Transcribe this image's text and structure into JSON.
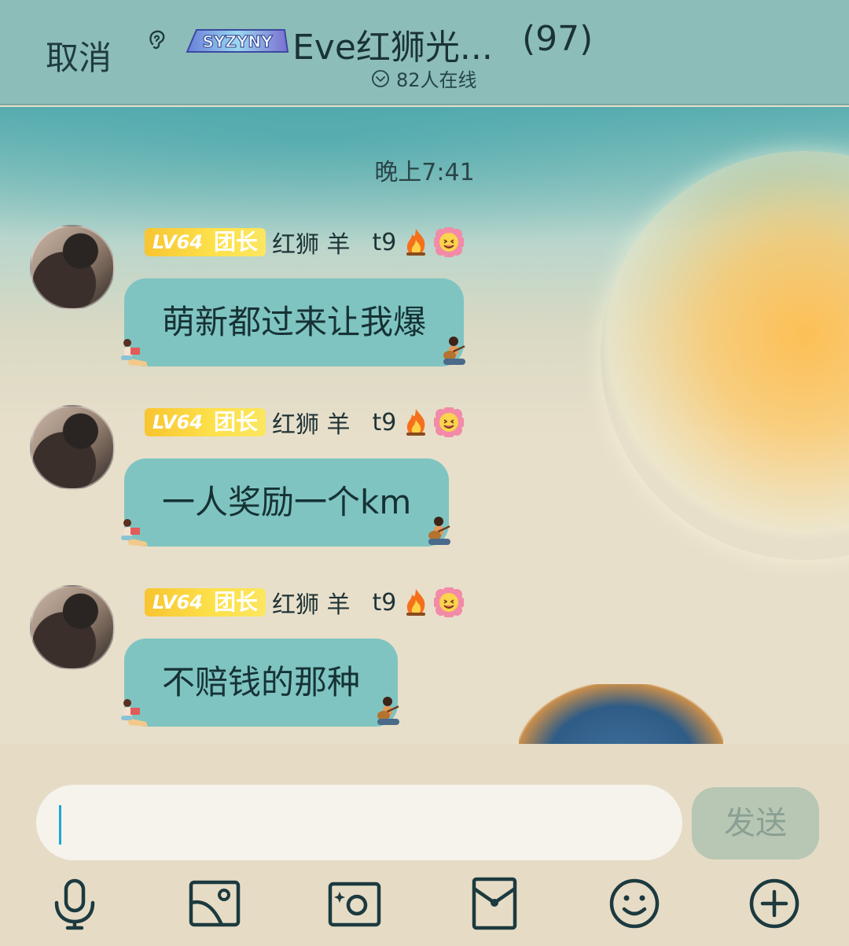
{
  "header": {
    "cancel_label": "取消",
    "badge_text": "SYZYNY",
    "title": "Eve红狮光...",
    "member_count": "(97)",
    "online_text": "82人在线"
  },
  "chat": {
    "timestamp": "晚上7:41",
    "messages": [
      {
        "level": "LV64",
        "role": "团长",
        "sender": "红狮 羊",
        "suffix": "t9",
        "text": "萌新都过来让我爆"
      },
      {
        "level": "LV64",
        "role": "团长",
        "sender": "红狮 羊",
        "suffix": "t9",
        "text": "一人奖励一个km"
      },
      {
        "level": "LV64",
        "role": "团长",
        "sender": "红狮 羊",
        "suffix": "t9",
        "text": "不赔钱的那种"
      }
    ]
  },
  "composer": {
    "input_value": "",
    "send_label": "发送"
  },
  "toolbar": {
    "items": [
      "microphone-icon",
      "image-icon",
      "camera-icon",
      "red-packet-icon",
      "emoji-icon",
      "plus-icon"
    ]
  },
  "colors": {
    "header_bg": "#8dbdb8",
    "bubble_bg": "#7fc4c1",
    "level_badge": "#f7c531",
    "send_disabled": "#b8c6b4",
    "caret": "#1aa7d6"
  }
}
